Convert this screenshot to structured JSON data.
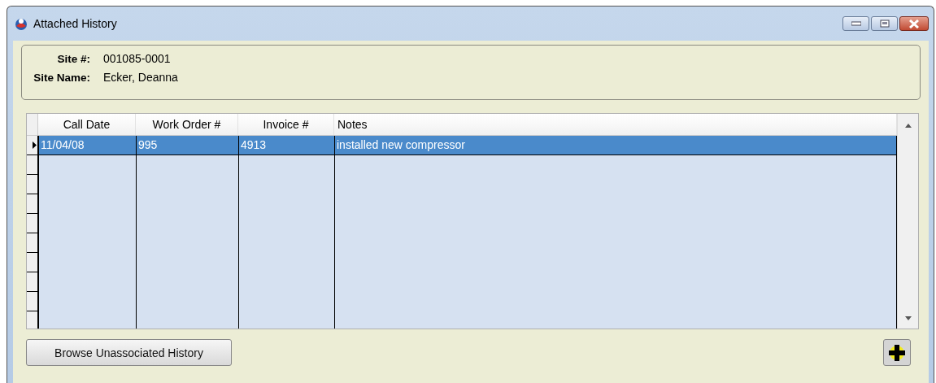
{
  "window": {
    "title": "Attached History"
  },
  "site": {
    "fields": [
      {
        "label": "Site #:",
        "value": "001085-0001"
      },
      {
        "label": "Site Name:",
        "value": "Ecker, Deanna"
      }
    ]
  },
  "table": {
    "columns": [
      "Call Date",
      "Work Order #",
      "Invoice #",
      "Notes"
    ],
    "rows": [
      {
        "cells": [
          "11/04/08",
          "995",
          "4913",
          "installed new compressor"
        ],
        "selected": true
      }
    ]
  },
  "buttons": {
    "browse": "Browse Unassociated History"
  }
}
